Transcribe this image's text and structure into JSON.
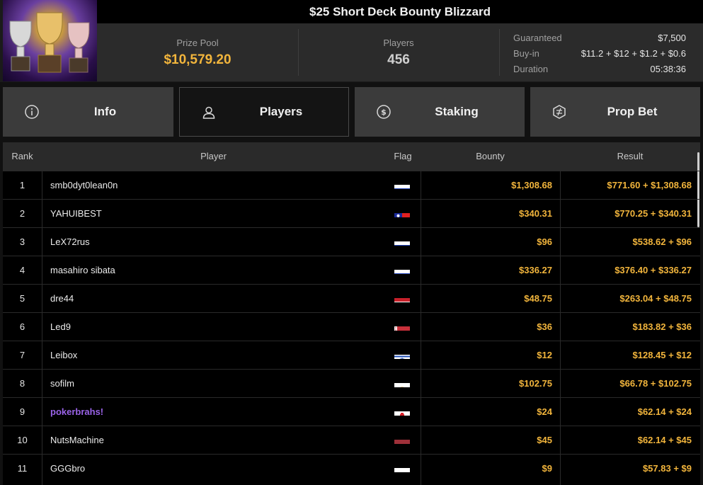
{
  "tournament": {
    "title": "$25 Short Deck Bounty Blizzard"
  },
  "stats": {
    "prize_pool_label": "Prize Pool",
    "prize_pool": "$10,579.20",
    "players_label": "Players",
    "players": "456",
    "guaranteed_label": "Guaranteed",
    "guaranteed": "$7,500",
    "buyin_label": "Buy-in",
    "buyin": "$11.2 + $12 + $1.2 + $0.6",
    "duration_label": "Duration",
    "duration": "05:38:36"
  },
  "tabs": [
    {
      "label": "Info",
      "icon": "info-icon",
      "active": false
    },
    {
      "label": "Players",
      "icon": "user-icon",
      "active": true
    },
    {
      "label": "Staking",
      "icon": "staking-coin-icon",
      "active": false
    },
    {
      "label": "Prop Bet",
      "icon": "prop-bet-icon",
      "active": false
    }
  ],
  "table": {
    "headers": {
      "rank": "Rank",
      "player": "Player",
      "flag": "Flag",
      "bounty": "Bounty",
      "result": "Result"
    },
    "rows": [
      {
        "rank": "1",
        "player": "smb0dyt0lean0n",
        "flag": "russia",
        "bounty": "$1,308.68",
        "result": "$771.60 + $1,308.68",
        "highlight": false
      },
      {
        "rank": "2",
        "player": "YAHUIBEST",
        "flag": "taiwan",
        "bounty": "$340.31",
        "result": "$770.25 + $340.31",
        "highlight": false
      },
      {
        "rank": "3",
        "player": "LeX72rus",
        "flag": "russia",
        "bounty": "$96",
        "result": "$538.62 + $96",
        "highlight": false
      },
      {
        "rank": "4",
        "player": "masahiro sibata",
        "flag": "russia",
        "bounty": "$336.27",
        "result": "$376.40 + $336.27",
        "highlight": false
      },
      {
        "rank": "5",
        "player": "dre44",
        "flag": "netherlands",
        "bounty": "$48.75",
        "result": "$263.04 + $48.75",
        "highlight": false
      },
      {
        "rank": "6",
        "player": "Led9",
        "flag": "belarus",
        "bounty": "$36",
        "result": "$183.82 + $36",
        "highlight": false
      },
      {
        "rank": "7",
        "player": "Leibox",
        "flag": "israel",
        "bounty": "$12",
        "result": "$128.45 + $12",
        "highlight": false
      },
      {
        "rank": "8",
        "player": "sofilm",
        "flag": "cyprus",
        "bounty": "$102.75",
        "result": "$66.78 + $102.75",
        "highlight": false
      },
      {
        "rank": "9",
        "player": "pokerbrahs!",
        "flag": "gibraltar",
        "bounty": "$24",
        "result": "$62.14 + $24",
        "highlight": true
      },
      {
        "rank": "10",
        "player": "NutsMachine",
        "flag": "latvia",
        "bounty": "$45",
        "result": "$62.14 + $45",
        "highlight": false
      },
      {
        "rank": "11",
        "player": "GGGbro",
        "flag": "poland",
        "bounty": "$9",
        "result": "$57.83 + $9",
        "highlight": false
      }
    ]
  },
  "colors": {
    "accent_gold": "#f2b53c",
    "highlight_purple": "#9a63e8"
  }
}
